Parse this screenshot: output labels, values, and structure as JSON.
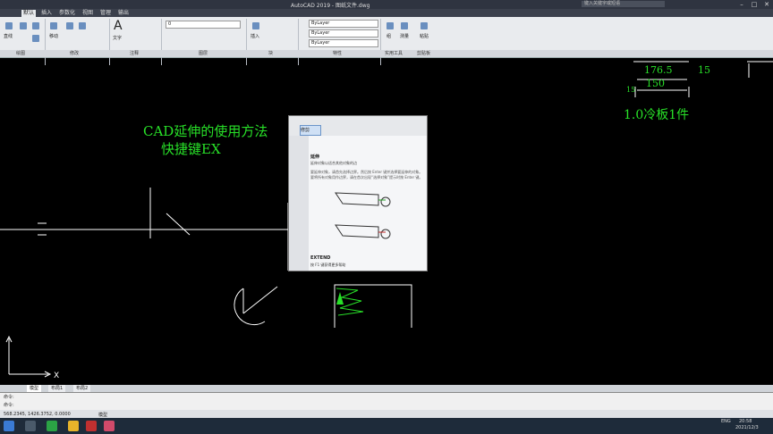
{
  "titlebar": {
    "title": "AutoCAD 2019 - 图纸文件.dwg",
    "search_placeholder": "键入关键字或短语"
  },
  "ribbon_tabs": [
    "默认",
    "插入",
    "参数化",
    "视图",
    "管理",
    "输出"
  ],
  "panels": [
    "绘图",
    "修改",
    "注释",
    "图层",
    "块",
    "特性",
    "实用工具",
    "剪贴板"
  ],
  "ribbon": {
    "draw_labels": [
      "直线",
      "多段线",
      "圆",
      "圆弧"
    ],
    "modify_labels": [
      "移动",
      "复制",
      "拉伸"
    ],
    "annotation_label": "文字",
    "insert_label": "插入",
    "layer_combo": "0",
    "bylayer1": "ByLayer",
    "bylayer2": "ByLayer",
    "bylayer3": "ByLayer",
    "group_label": "组",
    "measure_label": "测量",
    "paste_label": "粘贴"
  },
  "canvas": {
    "title": "CAD延伸的使用方法",
    "subtitle": "快捷键EX",
    "note": "1.0冷板1件",
    "dims": [
      "176.5",
      "15",
      "150",
      "15"
    ],
    "x_axis": "X"
  },
  "tooltip": {
    "tab_label": "修剪",
    "cmd_name": "延伸",
    "desc": "延伸对象以适合其他对象的边",
    "body": "要延伸对象，请首先选择边界。然后按 Enter 键并选择要延伸的对象。要将所有对象用作边界，请在首次出现“选择对象”提示时按 Enter 键。",
    "command": "EXTEND",
    "help": "按 F1 键获得更多帮助"
  },
  "layout_tabs": [
    "模型",
    "布局1",
    "布局2"
  ],
  "cmd": {
    "line1": "命令:",
    "line2": "命令:"
  },
  "status": {
    "coords": "568.2345, 1426.3752, 0.0000",
    "mode": "模型"
  },
  "taskbar": {
    "time": "20:58",
    "date": "2021/12/3",
    "lang": "ENG"
  }
}
